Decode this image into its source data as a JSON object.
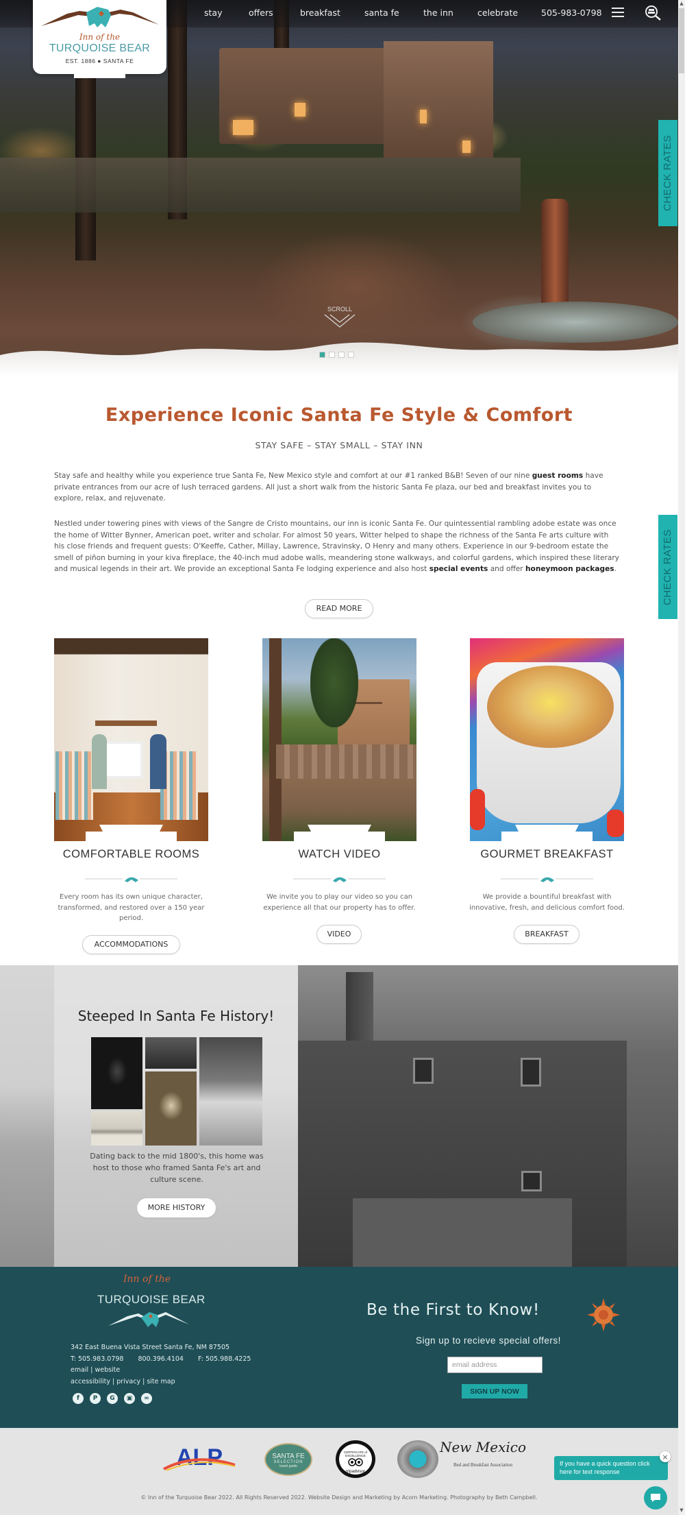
{
  "brand": {
    "script": "Inn of the",
    "name": "TURQUOISE BEAR",
    "est": "EST. 1886  ●  SANTA FE"
  },
  "nav": {
    "items": [
      {
        "label": "stay"
      },
      {
        "label": "offers"
      },
      {
        "label": "breakfast"
      },
      {
        "label": "santa fe"
      },
      {
        "label": "the inn"
      },
      {
        "label": "celebrate"
      }
    ],
    "phone": "505-983-0798",
    "menu_icon": "hamburger-icon",
    "book_icon": "bed-search-icon"
  },
  "hero": {
    "scroll_label": "SCROLL",
    "slides": 4,
    "active_slide": 1
  },
  "check_rates_label": "CHECK RATES",
  "intro": {
    "title": "Experience Iconic Santa Fe Style & Comfort",
    "subtitle": "STAY SAFE – STAY SMALL – STAY INN",
    "p1_a": "Stay safe and healthy while you experience true Santa Fe, New Mexico style and comfort at our #1 ranked B&B! Seven of our nine ",
    "p1_link": "guest rooms",
    "p1_b": " have private entrances from our acre of lush terraced gardens. All just a short walk from the historic Santa Fe plaza, our bed and breakfast invites you to explore, relax, and rejuvenate.",
    "p2_a": "Nestled under towering pines with views of the Sangre de Cristo mountains, our inn is iconic Santa Fe. Our quintessential rambling adobe estate was once the home of Witter Bynner, American poet, writer and scholar. For almost 50 years, Witter helped to shape the richness of the Santa Fe arts culture with his close friends and frequent guests: O'Keeffe, Cather, Millay, Lawrence, Stravinsky, O Henry and many others. Experience in our 9-bedroom estate the smell of piñon burning in your kiva fireplace, the 40-inch mud adobe walls, meandering stone walkways, and colorful gardens, which inspired these literary and musical legends in their art. We provide an exceptional Santa Fe lodging experience and also host ",
    "p2_link1": "special events",
    "p2_b": " and offer ",
    "p2_link2": "honeymoon packages",
    "p2_c": ".",
    "read_more": "READ MORE"
  },
  "cards": [
    {
      "title": "COMFORTABLE ROOMS",
      "text": "Every room has its own unique character, transformed, and restored over a 150 year period.",
      "button": "ACCOMMODATIONS"
    },
    {
      "title": "WATCH VIDEO",
      "text": "We invite you to play our video so you can experience all that our property has to offer.",
      "button": "VIDEO"
    },
    {
      "title": "GOURMET BREAKFAST",
      "text": "We provide a bountiful breakfast with innovative, fresh, and delicious comfort food.",
      "button": "BREAKFAST"
    }
  ],
  "history": {
    "title": "Steeped In Santa Fe History!",
    "text": "Dating back to the mid 1800's, this home was host to those who framed Santa Fe's art and culture scene.",
    "button": "MORE HISTORY"
  },
  "footer": {
    "script": "Inn of the",
    "name": "TURQUOISE BEAR",
    "address": "342 East Buena Vista Street Santa Fe, NM 87505",
    "phone": "T: 505.983.0798",
    "tollfree": "800.396.4104",
    "fax": "F: 505.988.4225",
    "links1": [
      {
        "label": "email"
      },
      {
        "label": "website"
      }
    ],
    "links2": [
      {
        "label": "accessibility"
      },
      {
        "label": "privacy"
      },
      {
        "label": "site map"
      }
    ],
    "social": [
      {
        "name": "facebook",
        "glyph": "f"
      },
      {
        "name": "pinterest",
        "glyph": "P"
      },
      {
        "name": "google",
        "glyph": "G"
      },
      {
        "name": "instagram",
        "glyph": "▣"
      },
      {
        "name": "tripadvisor",
        "glyph": "∞"
      }
    ],
    "newsletter": {
      "title": "Be the First to Know!",
      "subtitle": "Sign up to recieve special offers!",
      "placeholder": "email address",
      "value": "",
      "button": "SIGN UP NOW"
    }
  },
  "badges": [
    {
      "name": "ALP"
    },
    {
      "name": "SANTA FE",
      "sub": "SELECTION",
      "sub2": "travel guide"
    },
    {
      "name": "tripadvisor",
      "sub": "CERTIFICATE of EXCELLENCE"
    },
    {
      "name": "New Mexico",
      "sub": "Bed and Breakfast Association"
    }
  ],
  "copyright": "© Inn of the Turquoise Bear 2022. All Rights Reserved 2022. Website Design and Marketing by Acorn Marketing. Photography by Beth Campbell.",
  "chat": {
    "message": "If you have a quick question click here for text response",
    "close": "×"
  },
  "colors": {
    "accent_teal": "#20b3b0",
    "title_rust": "#b9582f",
    "footer_teal": "#1f4e56"
  }
}
